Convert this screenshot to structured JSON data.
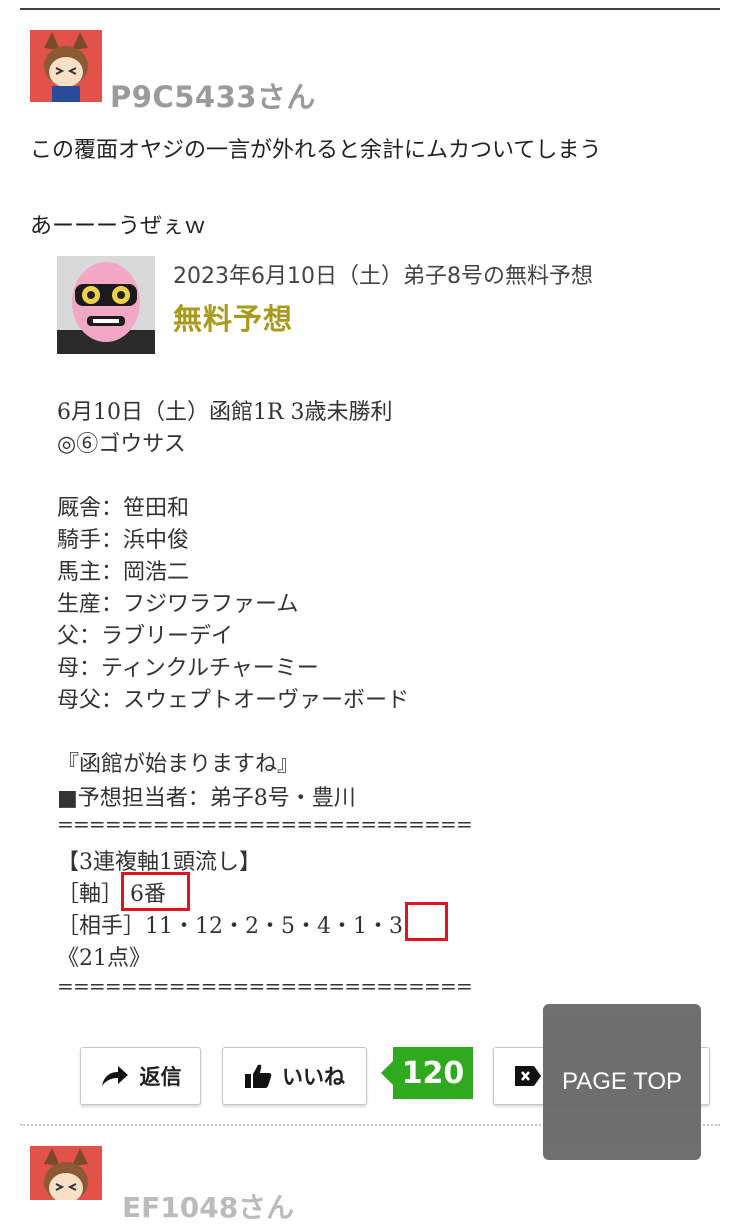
{
  "post": {
    "username": "P9C5433さん",
    "comment_lines": [
      "この覆面オヤジの一言が外れると余計にムカついてしまう",
      "あーーーうぜぇｗ"
    ]
  },
  "embed": {
    "title": "2023年6月10日（土）弟子8号の無料予想",
    "subtitle": "無料予想",
    "lines": [
      "6月10日（土）函館1R 3歳未勝利",
      "◎⑥ゴウサス",
      "",
      "厩舎：笹田和",
      "騎手：浜中俊",
      "馬主：岡浩二",
      "生産：フジワラファーム",
      "父：ラブリーデイ",
      "母：ティンクルチャーミー",
      "母父：スウェプトオーヴァーボード",
      "",
      "『函館が始まりますね』",
      "■予想担当者：弟子8号・豊川",
      "==========================",
      "【3連複軸1頭流し】",
      "［軸］ 6番",
      "［相手］11・12・2・5・4・1・3",
      "《21点》",
      "=========================="
    ]
  },
  "actions": {
    "reply_label": "返信",
    "like_label": "いいね",
    "like_count": "120",
    "page_top_label": "PAGE TOP"
  },
  "next_post": {
    "username_partial": "EF1048さん"
  }
}
